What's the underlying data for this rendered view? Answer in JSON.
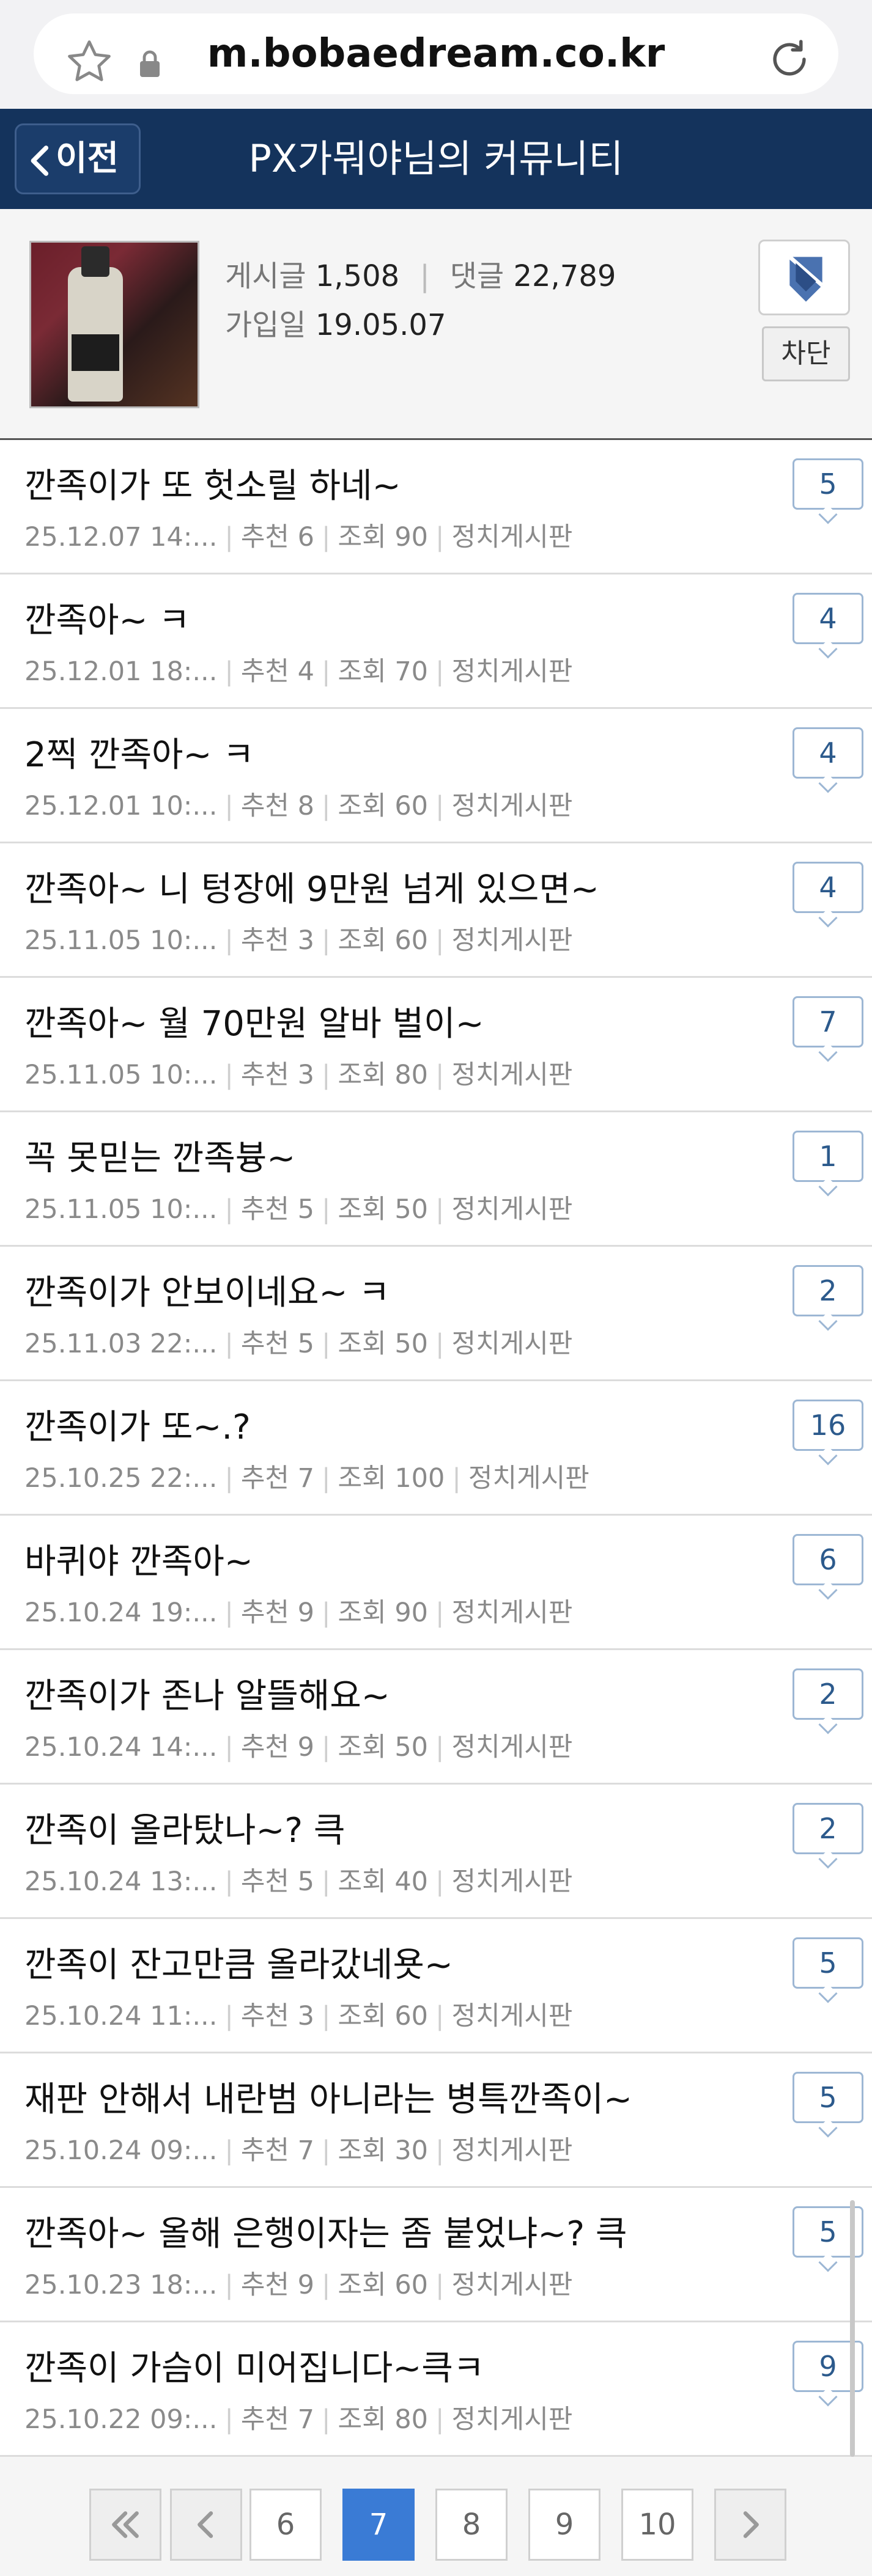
{
  "browser": {
    "url": "m.bobaedream.co.kr"
  },
  "header": {
    "back_label": "이전",
    "title": "PX가뭐야님의 커뮤니티"
  },
  "profile": {
    "posts_label": "게시글",
    "posts_count": "1,508",
    "comments_label": "댓글",
    "comments_count": "22,789",
    "joined_label": "가입일",
    "joined_date": "19.05.07",
    "block_label": "차단"
  },
  "posts": [
    {
      "title": "깐족이가 또 헛소릴 하네~",
      "date": "25.12.07 14:...",
      "recommend": "추천 6",
      "views": "조회 90",
      "board": "정치게시판",
      "comments": "5"
    },
    {
      "title": "깐족아~ ㅋ",
      "date": "25.12.01 18:...",
      "recommend": "추천 4",
      "views": "조회 70",
      "board": "정치게시판",
      "comments": "4"
    },
    {
      "title": "2찍 깐족아~ ㅋ",
      "date": "25.12.01 10:...",
      "recommend": "추천 8",
      "views": "조회 60",
      "board": "정치게시판",
      "comments": "4"
    },
    {
      "title": "깐족아~ 니 텅장에 9만원 넘게 있으면~",
      "date": "25.11.05 10:...",
      "recommend": "추천 3",
      "views": "조회 60",
      "board": "정치게시판",
      "comments": "4"
    },
    {
      "title": "깐족아~ 월 70만원 알바 벌이~",
      "date": "25.11.05 10:...",
      "recommend": "추천 3",
      "views": "조회 80",
      "board": "정치게시판",
      "comments": "7"
    },
    {
      "title": "꼭 못믿는 깐족븅~",
      "date": "25.11.05 10:...",
      "recommend": "추천 5",
      "views": "조회 50",
      "board": "정치게시판",
      "comments": "1"
    },
    {
      "title": "깐족이가 안보이네요~ ㅋ",
      "date": "25.11.03 22:...",
      "recommend": "추천 5",
      "views": "조회 50",
      "board": "정치게시판",
      "comments": "2"
    },
    {
      "title": "깐족이가 또~.?",
      "date": "25.10.25 22:...",
      "recommend": "추천 7",
      "views": "조회 100",
      "board": "정치게시판",
      "comments": "16"
    },
    {
      "title": "바퀴야 깐족아~",
      "date": "25.10.24 19:...",
      "recommend": "추천 9",
      "views": "조회 90",
      "board": "정치게시판",
      "comments": "6"
    },
    {
      "title": "깐족이가 존나 알뜰해요~",
      "date": "25.10.24 14:...",
      "recommend": "추천 9",
      "views": "조회 50",
      "board": "정치게시판",
      "comments": "2"
    },
    {
      "title": "깐족이 올라탔나~? 큭",
      "date": "25.10.24 13:...",
      "recommend": "추천 5",
      "views": "조회 40",
      "board": "정치게시판",
      "comments": "2"
    },
    {
      "title": "깐족이 잔고만큼 올라갔네욧~",
      "date": "25.10.24 11:...",
      "recommend": "추천 3",
      "views": "조회 60",
      "board": "정치게시판",
      "comments": "5"
    },
    {
      "title": "재판 안해서 내란범 아니라는 병특깐족이~",
      "date": "25.10.24 09:...",
      "recommend": "추천 7",
      "views": "조회 30",
      "board": "정치게시판",
      "comments": "5"
    },
    {
      "title": "깐족아~ 올해 은행이자는 좀 붙었냐~? 큭",
      "date": "25.10.23 18:...",
      "recommend": "추천 9",
      "views": "조회 60",
      "board": "정치게시판",
      "comments": "5"
    },
    {
      "title": "깐족이 가슴이 미어집니다~큭ㅋ",
      "date": "25.10.22 09:...",
      "recommend": "추천 7",
      "views": "조회 80",
      "board": "정치게시판",
      "comments": "9"
    }
  ],
  "pagination": {
    "pages": [
      "6",
      "7",
      "8",
      "9",
      "10"
    ],
    "current": "7"
  },
  "colors": {
    "header_bg": "#14335c",
    "active_page": "#3a7bd5",
    "comment_badge_border": "#9db7d4"
  }
}
